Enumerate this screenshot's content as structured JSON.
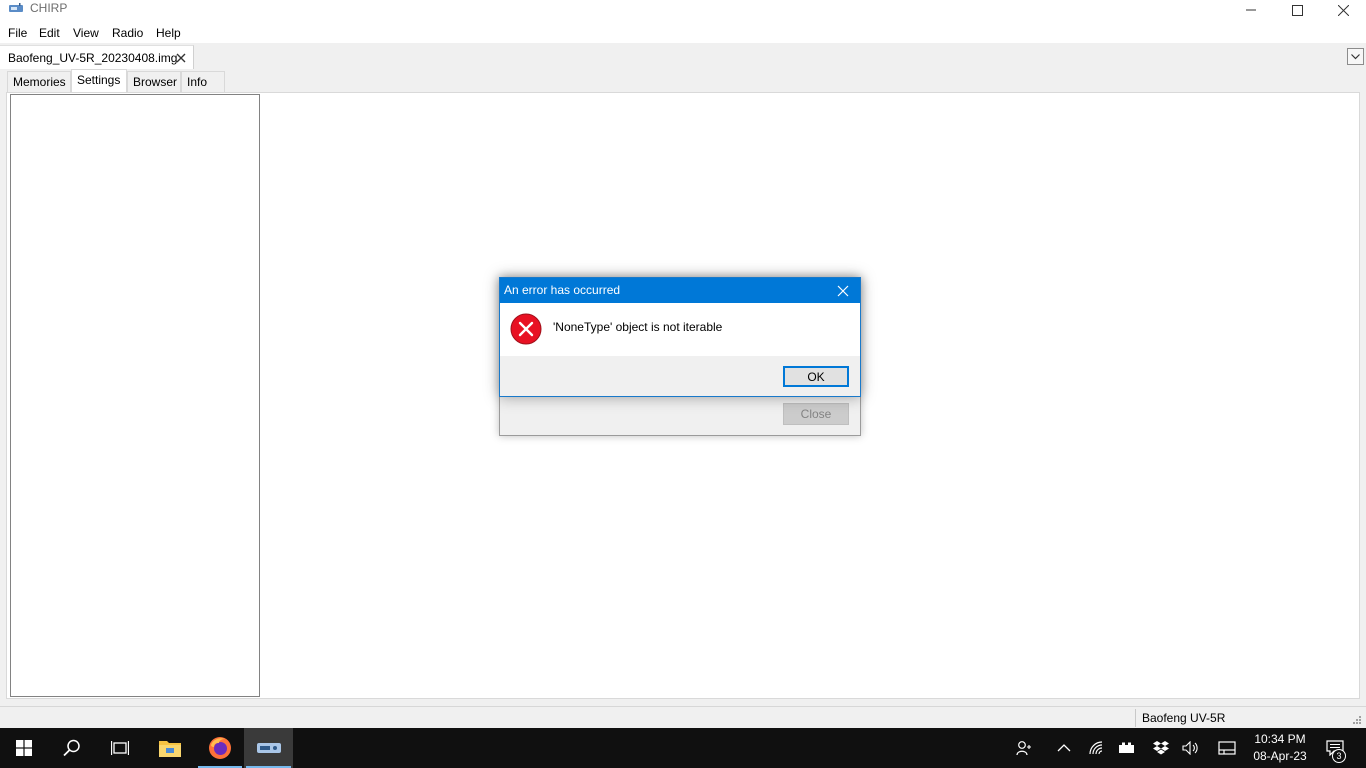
{
  "window": {
    "title": "CHIRP",
    "app_icon": "chirp-radio-icon",
    "controls": {
      "minimize": "minimize-icon",
      "maximize": "maximize-icon",
      "close": "close-icon"
    }
  },
  "menubar": {
    "items": [
      {
        "label": "File"
      },
      {
        "label": "Edit"
      },
      {
        "label": "View"
      },
      {
        "label": "Radio"
      },
      {
        "label": "Help"
      }
    ]
  },
  "document_tabs": {
    "active": {
      "label": "Baofeng_UV-5R_20230408.img",
      "close_icon": "close-icon"
    },
    "dropdown_icon": "chevron-down-icon"
  },
  "notebook_tabs": {
    "items": [
      {
        "label": "Memories"
      },
      {
        "label": "Settings"
      },
      {
        "label": "Browser"
      },
      {
        "label": "Info"
      }
    ],
    "selected": "Settings"
  },
  "statusbar": {
    "radio_model": "Baofeng UV-5R"
  },
  "background_dialog": {
    "close_label": "Close",
    "close_enabled": false
  },
  "error_dialog": {
    "title": "An error has occurred",
    "message": "'NoneType' object is not iterable",
    "icon": "error-icon",
    "ok_label": "OK"
  },
  "taskbar": {
    "icons": [
      "windows-start-icon",
      "search-icon",
      "task-view-icon",
      "file-explorer-icon",
      "firefox-icon",
      "chirp-app-icon"
    ],
    "tray_icons": [
      "people-icon",
      "chevron-up-icon",
      "wifi-icon",
      "battery-icon",
      "dropbox-icon",
      "volume-icon",
      "keyboard-layout-icon"
    ],
    "clock": {
      "time": "10:34 PM",
      "date": "08-Apr-23"
    },
    "notification_count": "3"
  },
  "colors": {
    "accent": "#0078d7",
    "error_red": "#e81123",
    "taskbar": "#101010",
    "window_bg": "#f0f0f0"
  }
}
